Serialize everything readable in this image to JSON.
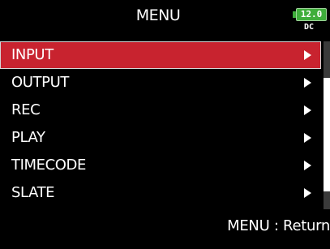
{
  "header": {
    "title": "MENU"
  },
  "battery": {
    "voltage": "12.0",
    "source": "DC",
    "color": "#3fae3b"
  },
  "menu": {
    "selected_color": "#c8232f",
    "items": [
      {
        "label": "INPUT",
        "selected": true
      },
      {
        "label": "OUTPUT",
        "selected": false
      },
      {
        "label": "REC",
        "selected": false
      },
      {
        "label": "PLAY",
        "selected": false
      },
      {
        "label": "TIMECODE",
        "selected": false
      },
      {
        "label": "SLATE",
        "selected": false
      }
    ]
  },
  "footer": {
    "hint": "MENU : Return"
  }
}
